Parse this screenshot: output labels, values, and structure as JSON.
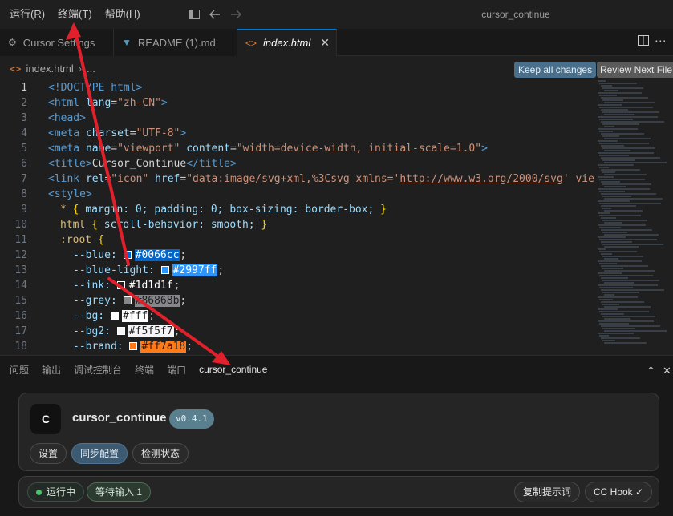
{
  "titlebar": {
    "menu": [
      "运行(R)",
      "终端(T)",
      "帮助(H)"
    ],
    "window_title": "cursor_continue"
  },
  "tabs": [
    {
      "label": "Cursor Settings",
      "icon": "gear-icon"
    },
    {
      "label": "README (1).md",
      "icon": "markdown-icon"
    },
    {
      "label": "index.html",
      "icon": "html-icon"
    }
  ],
  "breadcrumb": {
    "file": "index.html",
    "rest": "..."
  },
  "diff_actions": {
    "keep": "Keep all changes",
    "review": "Review Next File"
  },
  "editor": {
    "line_numbers": [
      "1",
      "2",
      "3",
      "4",
      "5",
      "6",
      "7",
      "8",
      "9",
      "10",
      "11",
      "12",
      "13",
      "14",
      "15",
      "16",
      "17",
      "18"
    ],
    "lines": {
      "l1": "<!DOCTYPE html>",
      "l2_tag": "<html",
      "l2_attr": "lang",
      "l2_val": "\"zh-CN\"",
      "l2_end": ">",
      "l3": "<head>",
      "l4_tag": "<meta",
      "l4_attr": "charset",
      "l4_val": "\"UTF-8\"",
      "l4_end": ">",
      "l5_tag": "<meta",
      "l5_attr1": "name",
      "l5_val1": "\"viewport\"",
      "l5_attr2": "content",
      "l5_val2": "\"width=device-width, initial-scale=1.0\"",
      "l5_end": ">",
      "l6_open": "<title>",
      "l6_text": "Cursor_Continue",
      "l6_close": "</title>",
      "l7_tag": "<link",
      "l7_attr1": "rel",
      "l7_val1": "\"icon\"",
      "l7_attr2": "href",
      "l7_val2a": "\"data:image/svg+xml,%3Csvg xmlns='",
      "l7_link": "http://www.w3.org/2000/svg",
      "l7_val2b": "' viewB",
      "l8": "<style>",
      "l9_sel": "* ",
      "l9_body": "margin: 0; padding: 0; box-sizing: border-box;",
      "l10_sel": "html ",
      "l10_body": "scroll-behavior: smooth;",
      "l11_sel": ":root ",
      "l12_prop": "--blue:",
      "l12_val": "#0066cc",
      "l13_prop": "--blue-light:",
      "l13_val": "#2997ff",
      "l14_prop": "--ink:",
      "l14_val": "#1d1d1f",
      "l15_prop": "--grey:",
      "l15_val": "#86868b",
      "l16_prop": "--bg:",
      "l16_val": "#fff",
      "l17_prop": "--bg2:",
      "l17_val": "#f5f5f7",
      "l18_prop": "--brand:",
      "l18_val": "#ff7a18"
    }
  },
  "panel_tabs": [
    "问题",
    "输出",
    "调试控制台",
    "终端",
    "端口",
    "cursor_continue"
  ],
  "extension": {
    "logo_letter": "C",
    "name": "cursor_continue",
    "version": "v0.4.1",
    "buttons": [
      "设置",
      "同步配置",
      "检测状态"
    ],
    "status_running": "运行中",
    "status_waiting": "等待输入 1",
    "copy_prompt": "复制提示词",
    "cc_hook": "CC Hook ✓"
  },
  "colors": {
    "accent": "#0078d4",
    "arrow": "#e0202a",
    "running_dot": "#4cc36a"
  }
}
